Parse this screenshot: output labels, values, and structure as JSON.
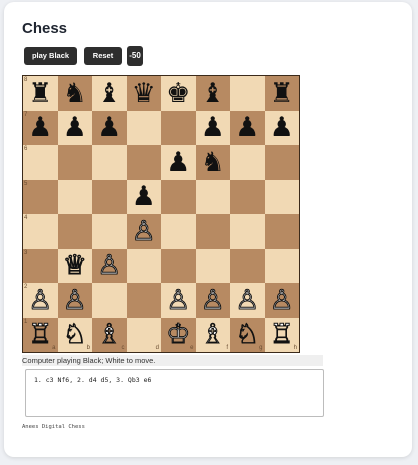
{
  "title": "Chess",
  "buttons": {
    "play_black": "play Black",
    "reset": "Reset",
    "score": "-50"
  },
  "board": {
    "ranks": [
      [
        "♜",
        "♞",
        "♝",
        "♛",
        "♚",
        "♝",
        "",
        "♜"
      ],
      [
        "♟",
        "♟",
        "♟",
        "",
        "",
        "♟",
        "♟",
        "♟"
      ],
      [
        "",
        "",
        "",
        "",
        "♟",
        "♞",
        "",
        ""
      ],
      [
        "",
        "",
        "",
        "♟",
        "",
        "",
        "",
        ""
      ],
      [
        "",
        "",
        "",
        "♙",
        "",
        "",
        "",
        ""
      ],
      [
        "",
        "♕",
        "♙",
        "",
        "",
        "",
        "",
        ""
      ],
      [
        "♙",
        "♙",
        "",
        "",
        "♙",
        "♙",
        "♙",
        "♙"
      ],
      [
        "♖",
        "♘",
        "♗",
        "",
        "♔",
        "♗",
        "♘",
        "♖"
      ]
    ],
    "rank_labels": [
      "8",
      "7",
      "6",
      "5",
      "4",
      "3",
      "2",
      "1"
    ],
    "file_labels": [
      "a",
      "b",
      "c",
      "d",
      "e",
      "f",
      "g",
      "h"
    ]
  },
  "status": "Computer playing Black; White to move.",
  "moves": "1. c3 Nf6, 2. d4 d5, 3. Qb3 e6",
  "footer": "Anees Digital Chess",
  "colors": {
    "light_square": "#f1d9b4",
    "dark_square": "#b78a62",
    "button_bg": "#2e2e2e"
  }
}
